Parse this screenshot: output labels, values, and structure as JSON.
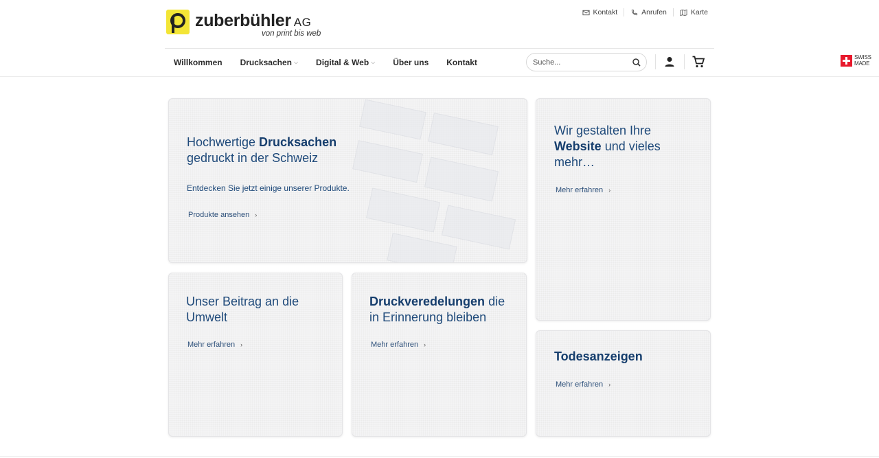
{
  "brand": {
    "name": "zuberbühler",
    "suffix": "AG",
    "tagline": "von print bis web",
    "logo_letter": "p"
  },
  "top_links": [
    {
      "label": "Kontakt",
      "icon": "mail-icon"
    },
    {
      "label": "Anrufen",
      "icon": "phone-icon"
    },
    {
      "label": "Karte",
      "icon": "map-icon"
    }
  ],
  "nav": [
    {
      "label": "Willkommen",
      "dropdown": false
    },
    {
      "label": "Drucksachen",
      "dropdown": true
    },
    {
      "label": "Digital & Web",
      "dropdown": true
    },
    {
      "label": "Über uns",
      "dropdown": false
    },
    {
      "label": "Kontakt",
      "dropdown": false
    }
  ],
  "search": {
    "placeholder": "Suche..."
  },
  "swiss_badge": {
    "line1": "SWISS",
    "line2": "MADE"
  },
  "tiles": {
    "hero": {
      "title_pre": "Hochwertige ",
      "title_bold": "Drucksachen",
      "title_post": "gedruckt in der Schweiz",
      "description": "Entdecken Sie jetzt einige unserer Produkte.",
      "link": "Produkte ansehen"
    },
    "web": {
      "title_pre": "Wir gestalten Ihre",
      "title_bold": "Website",
      "title_post": " und vieles",
      "title_end": "mehr…",
      "link": "Mehr erfahren"
    },
    "umwelt": {
      "title_line1": "Unser Beitrag an die",
      "title_line2": "Umwelt",
      "link": "Mehr erfahren"
    },
    "veredelung": {
      "title_bold": "Druckveredelungen",
      "title_post": " die",
      "title_line2": "in Erinnerung bleiben",
      "link": "Mehr erfahren"
    },
    "todes": {
      "title_bold": "Todesanzeigen",
      "link": "Mehr erfahren"
    }
  },
  "link_arrow": "›",
  "dropdown_chevron": "⌵",
  "colors": {
    "brand_yellow": "#f3e536",
    "tile_text": "#1f4a7a",
    "swiss_red": "#e8192c"
  }
}
